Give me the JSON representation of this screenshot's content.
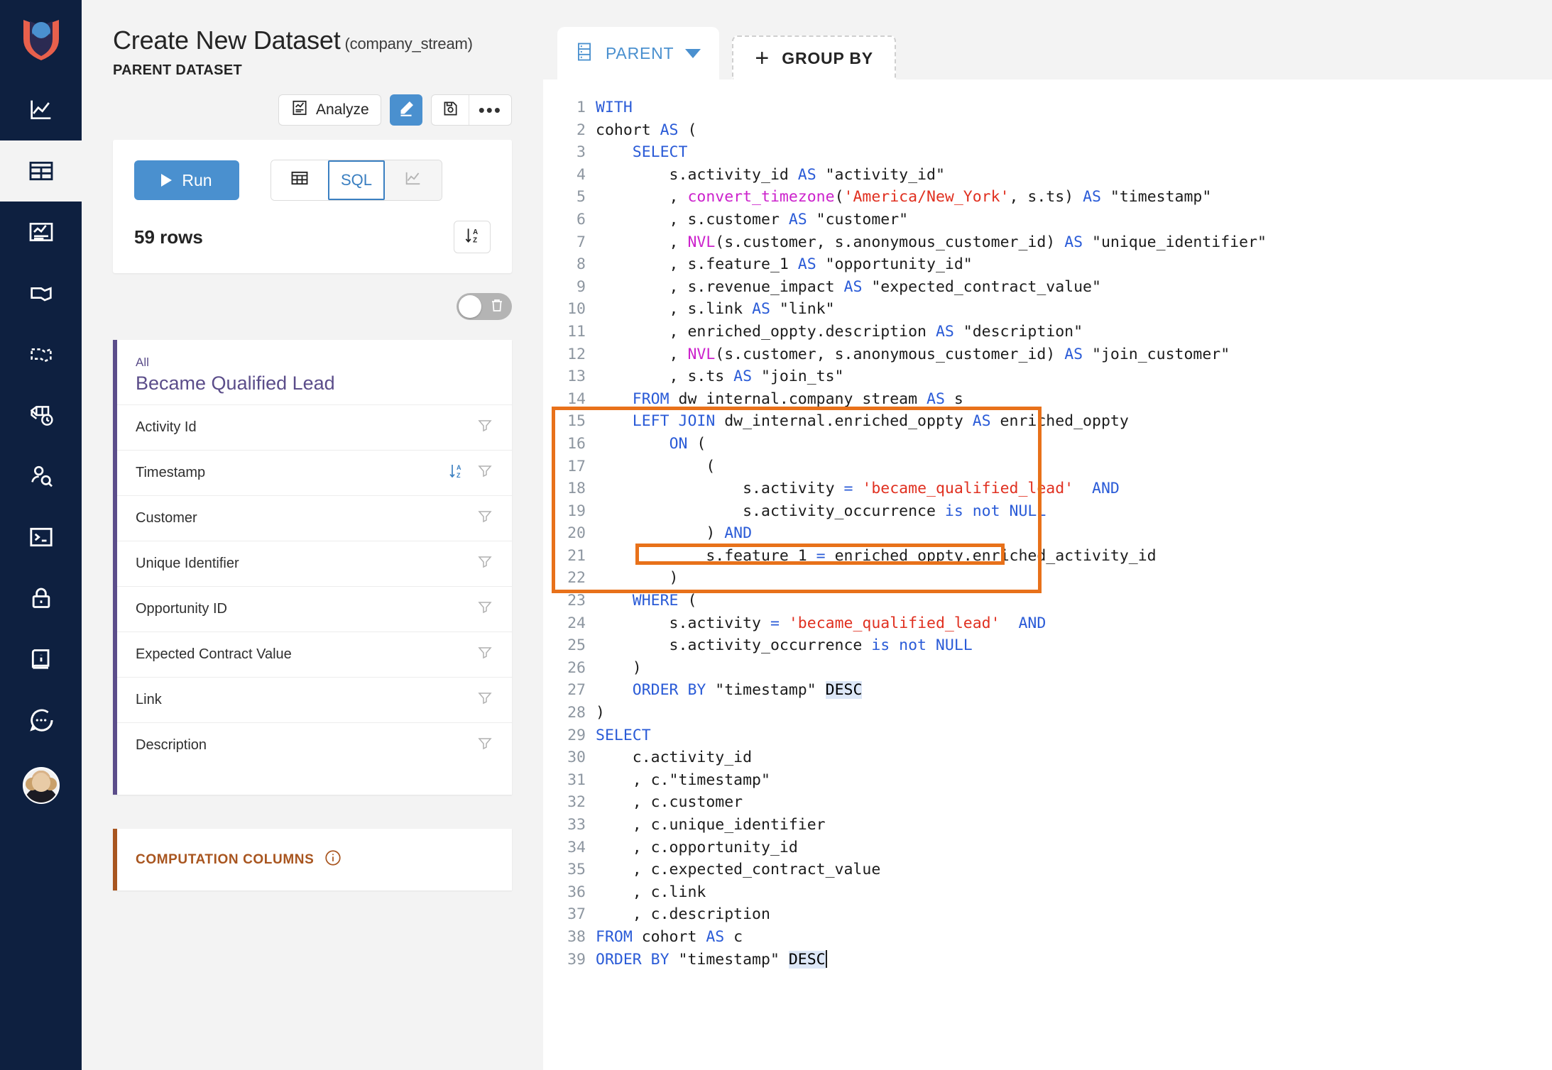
{
  "nav": {
    "logo_icon": "protocols-shield-logo",
    "items": [
      {
        "icon": "line-chart-icon",
        "name": "metrics",
        "active": false
      },
      {
        "icon": "table-grid-icon",
        "name": "datasets",
        "active": true
      },
      {
        "icon": "dashboard-icon",
        "name": "dashboards",
        "active": false
      },
      {
        "icon": "narrative-icon",
        "name": "narratives",
        "active": false
      },
      {
        "icon": "sketch-edit-icon",
        "name": "sketch",
        "active": false
      },
      {
        "icon": "activity-stream-clock-icon",
        "name": "activity-stream",
        "active": false
      },
      {
        "icon": "user-search-icon",
        "name": "customer-journey",
        "active": false
      },
      {
        "icon": "terminal-icon",
        "name": "terminal",
        "active": false
      },
      {
        "icon": "lock-icon",
        "name": "permissions",
        "active": false
      },
      {
        "icon": "info-book-icon",
        "name": "documentation",
        "active": false
      },
      {
        "icon": "chat-bubble-icon",
        "name": "support-chat",
        "active": false
      }
    ],
    "avatar_name": "user-avatar"
  },
  "header": {
    "title": "Create New Dataset",
    "title_suffix": "(company_stream)",
    "subtitle": "PARENT DATASET",
    "actions": {
      "analyze_label": "Analyze",
      "analyze_icon": "analyze-report-icon",
      "edit_icon": "pencil-edit-icon",
      "save_icon": "save-disk-icon",
      "more_icon": "ellipsis-icon"
    }
  },
  "run_card": {
    "run_label": "Run",
    "play_icon": "play-triangle-icon",
    "views": [
      {
        "label": "",
        "icon": "table-view-icon",
        "selected": false
      },
      {
        "label": "SQL",
        "icon": "",
        "selected": true
      },
      {
        "label": "",
        "icon": "plot-view-icon",
        "selected": false
      }
    ],
    "rows_count": "59",
    "rows_label": "rows",
    "sort_icon": "sort-az-icon"
  },
  "delete_toggle": {
    "name": "delete-toggle",
    "state": "off",
    "icon": "trash-icon"
  },
  "columns_card": {
    "group_label": "All",
    "group_name": "Became Qualified Lead",
    "accent": "#5b4d8a",
    "rows": [
      {
        "label": "Activity Id",
        "sorted": false,
        "filter_icon": "filter-icon"
      },
      {
        "label": "Timestamp",
        "sorted": true,
        "sort_icon": "sort-az-icon",
        "filter_icon": "filter-icon"
      },
      {
        "label": "Customer",
        "sorted": false,
        "filter_icon": "filter-icon"
      },
      {
        "label": "Unique Identifier",
        "sorted": false,
        "filter_icon": "filter-icon"
      },
      {
        "label": "Opportunity ID",
        "sorted": false,
        "filter_icon": "filter-icon"
      },
      {
        "label": "Expected Contract Value",
        "sorted": false,
        "filter_icon": "filter-icon"
      },
      {
        "label": "Link",
        "sorted": false,
        "filter_icon": "filter-icon"
      },
      {
        "label": "Description",
        "sorted": false,
        "filter_icon": "filter-icon"
      }
    ]
  },
  "computation_card": {
    "title": "COMPUTATION COLUMNS",
    "info_icon": "info-circle-icon",
    "accent": "#a8551f"
  },
  "tabs": {
    "active": {
      "label": "PARENT",
      "icon": "database-rows-icon",
      "caret_icon": "chevron-down-icon"
    },
    "add": {
      "label": "GROUP BY",
      "icon": "plus-icon"
    }
  },
  "annotations": {
    "color": "#e8711a",
    "boxes": [
      {
        "name": "left-join-block-highlight",
        "lines": [
          15,
          22
        ]
      },
      {
        "name": "join-condition-highlight",
        "lines": [
          21,
          21
        ]
      }
    ]
  },
  "editor": {
    "cursor_line": 39,
    "selection_text": "DESC",
    "lines": [
      {
        "n": 1,
        "tokens": [
          {
            "t": "kw",
            "v": "WITH"
          }
        ]
      },
      {
        "n": 2,
        "tokens": [
          {
            "t": "src",
            "v": "cohort "
          },
          {
            "t": "kw",
            "v": "AS"
          },
          {
            "t": "src",
            "v": " ("
          }
        ]
      },
      {
        "n": 3,
        "tokens": [
          {
            "t": "src",
            "v": "    "
          },
          {
            "t": "kw",
            "v": "SELECT"
          }
        ]
      },
      {
        "n": 4,
        "tokens": [
          {
            "t": "src",
            "v": "        s.activity_id "
          },
          {
            "t": "kw",
            "v": "AS"
          },
          {
            "t": "src",
            "v": " \"activity_id\""
          }
        ]
      },
      {
        "n": 5,
        "tokens": [
          {
            "t": "src",
            "v": "        , "
          },
          {
            "t": "fn",
            "v": "convert_timezone"
          },
          {
            "t": "src",
            "v": "("
          },
          {
            "t": "str",
            "v": "'America/New_York'"
          },
          {
            "t": "src",
            "v": ", s.ts) "
          },
          {
            "t": "kw",
            "v": "AS"
          },
          {
            "t": "src",
            "v": " \"timestamp\""
          }
        ]
      },
      {
        "n": 6,
        "tokens": [
          {
            "t": "src",
            "v": "        , s.customer "
          },
          {
            "t": "kw",
            "v": "AS"
          },
          {
            "t": "src",
            "v": " \"customer\""
          }
        ]
      },
      {
        "n": 7,
        "tokens": [
          {
            "t": "src",
            "v": "        , "
          },
          {
            "t": "fn",
            "v": "NVL"
          },
          {
            "t": "src",
            "v": "(s.customer, s.anonymous_customer_id) "
          },
          {
            "t": "kw",
            "v": "AS"
          },
          {
            "t": "src",
            "v": " \"unique_identifier\""
          }
        ]
      },
      {
        "n": 8,
        "tokens": [
          {
            "t": "src",
            "v": "        , s.feature_1 "
          },
          {
            "t": "kw",
            "v": "AS"
          },
          {
            "t": "src",
            "v": " \"opportunity_id\""
          }
        ]
      },
      {
        "n": 9,
        "tokens": [
          {
            "t": "src",
            "v": "        , s.revenue_impact "
          },
          {
            "t": "kw",
            "v": "AS"
          },
          {
            "t": "src",
            "v": " \"expected_contract_value\""
          }
        ]
      },
      {
        "n": 10,
        "tokens": [
          {
            "t": "src",
            "v": "        , s.link "
          },
          {
            "t": "kw",
            "v": "AS"
          },
          {
            "t": "src",
            "v": " \"link\""
          }
        ]
      },
      {
        "n": 11,
        "tokens": [
          {
            "t": "src",
            "v": "        , enriched_oppty.description "
          },
          {
            "t": "kw",
            "v": "AS"
          },
          {
            "t": "src",
            "v": " \"description\""
          }
        ]
      },
      {
        "n": 12,
        "tokens": [
          {
            "t": "src",
            "v": "        , "
          },
          {
            "t": "fn",
            "v": "NVL"
          },
          {
            "t": "src",
            "v": "(s.customer, s.anonymous_customer_id) "
          },
          {
            "t": "kw",
            "v": "AS"
          },
          {
            "t": "src",
            "v": " \"join_customer\""
          }
        ]
      },
      {
        "n": 13,
        "tokens": [
          {
            "t": "src",
            "v": "        , s.ts "
          },
          {
            "t": "kw",
            "v": "AS"
          },
          {
            "t": "src",
            "v": " \"join_ts\""
          }
        ]
      },
      {
        "n": 14,
        "tokens": [
          {
            "t": "src",
            "v": "    "
          },
          {
            "t": "kw",
            "v": "FROM"
          },
          {
            "t": "src",
            "v": " dw_internal.company_stream "
          },
          {
            "t": "kw",
            "v": "AS"
          },
          {
            "t": "src",
            "v": " s"
          }
        ]
      },
      {
        "n": 15,
        "tokens": [
          {
            "t": "src",
            "v": "    "
          },
          {
            "t": "kw",
            "v": "LEFT JOIN"
          },
          {
            "t": "src",
            "v": " dw_internal.enriched_oppty "
          },
          {
            "t": "kw",
            "v": "AS"
          },
          {
            "t": "src",
            "v": " enriched_oppty"
          }
        ]
      },
      {
        "n": 16,
        "tokens": [
          {
            "t": "src",
            "v": "        "
          },
          {
            "t": "kw",
            "v": "ON"
          },
          {
            "t": "src",
            "v": " ("
          }
        ]
      },
      {
        "n": 17,
        "tokens": [
          {
            "t": "src",
            "v": "            ("
          }
        ]
      },
      {
        "n": 18,
        "tokens": [
          {
            "t": "src",
            "v": "                s.activity "
          },
          {
            "t": "kw",
            "v": "="
          },
          {
            "t": "src",
            "v": " "
          },
          {
            "t": "str",
            "v": "'became_qualified_lead'"
          },
          {
            "t": "src",
            "v": "  "
          },
          {
            "t": "kw",
            "v": "AND"
          }
        ]
      },
      {
        "n": 19,
        "tokens": [
          {
            "t": "src",
            "v": "                s.activity_occurrence "
          },
          {
            "t": "kw",
            "v": "is not NULL"
          }
        ]
      },
      {
        "n": 20,
        "tokens": [
          {
            "t": "src",
            "v": "            ) "
          },
          {
            "t": "kw",
            "v": "AND"
          }
        ]
      },
      {
        "n": 21,
        "tokens": [
          {
            "t": "src",
            "v": "            s.feature_1 "
          },
          {
            "t": "kw",
            "v": "="
          },
          {
            "t": "src",
            "v": " enriched_oppty.enriched_activity_id"
          }
        ]
      },
      {
        "n": 22,
        "tokens": [
          {
            "t": "src",
            "v": "        )"
          }
        ]
      },
      {
        "n": 23,
        "tokens": [
          {
            "t": "src",
            "v": "    "
          },
          {
            "t": "kw",
            "v": "WHERE"
          },
          {
            "t": "src",
            "v": " ("
          }
        ]
      },
      {
        "n": 24,
        "tokens": [
          {
            "t": "src",
            "v": "        s.activity "
          },
          {
            "t": "kw",
            "v": "="
          },
          {
            "t": "src",
            "v": " "
          },
          {
            "t": "str",
            "v": "'became_qualified_lead'"
          },
          {
            "t": "src",
            "v": "  "
          },
          {
            "t": "kw",
            "v": "AND"
          }
        ]
      },
      {
        "n": 25,
        "tokens": [
          {
            "t": "src",
            "v": "        s.activity_occurrence "
          },
          {
            "t": "kw",
            "v": "is not NULL"
          }
        ]
      },
      {
        "n": 26,
        "tokens": [
          {
            "t": "src",
            "v": "    )"
          }
        ]
      },
      {
        "n": 27,
        "tokens": [
          {
            "t": "src",
            "v": "    "
          },
          {
            "t": "kw",
            "v": "ORDER BY"
          },
          {
            "t": "src",
            "v": " \"timestamp\" "
          },
          {
            "t": "hl",
            "v": "DESC"
          }
        ]
      },
      {
        "n": 28,
        "tokens": [
          {
            "t": "src",
            "v": ")"
          }
        ]
      },
      {
        "n": 29,
        "tokens": [
          {
            "t": "kw",
            "v": "SELECT"
          }
        ]
      },
      {
        "n": 30,
        "tokens": [
          {
            "t": "src",
            "v": "    c.activity_id"
          }
        ]
      },
      {
        "n": 31,
        "tokens": [
          {
            "t": "src",
            "v": "    , c.\"timestamp\""
          }
        ]
      },
      {
        "n": 32,
        "tokens": [
          {
            "t": "src",
            "v": "    , c.customer"
          }
        ]
      },
      {
        "n": 33,
        "tokens": [
          {
            "t": "src",
            "v": "    , c.unique_identifier"
          }
        ]
      },
      {
        "n": 34,
        "tokens": [
          {
            "t": "src",
            "v": "    , c.opportunity_id"
          }
        ]
      },
      {
        "n": 35,
        "tokens": [
          {
            "t": "src",
            "v": "    , c.expected_contract_value"
          }
        ]
      },
      {
        "n": 36,
        "tokens": [
          {
            "t": "src",
            "v": "    , c.link"
          }
        ]
      },
      {
        "n": 37,
        "tokens": [
          {
            "t": "src",
            "v": "    , c.description"
          }
        ]
      },
      {
        "n": 38,
        "tokens": [
          {
            "t": "kw",
            "v": "FROM"
          },
          {
            "t": "src",
            "v": " cohort "
          },
          {
            "t": "kw",
            "v": "AS"
          },
          {
            "t": "src",
            "v": " c"
          }
        ]
      },
      {
        "n": 39,
        "tokens": [
          {
            "t": "kw",
            "v": "ORDER BY"
          },
          {
            "t": "src",
            "v": " \"timestamp\" "
          },
          {
            "t": "hl",
            "v": "DESC"
          },
          {
            "t": "cursor",
            "v": ""
          }
        ]
      }
    ]
  }
}
